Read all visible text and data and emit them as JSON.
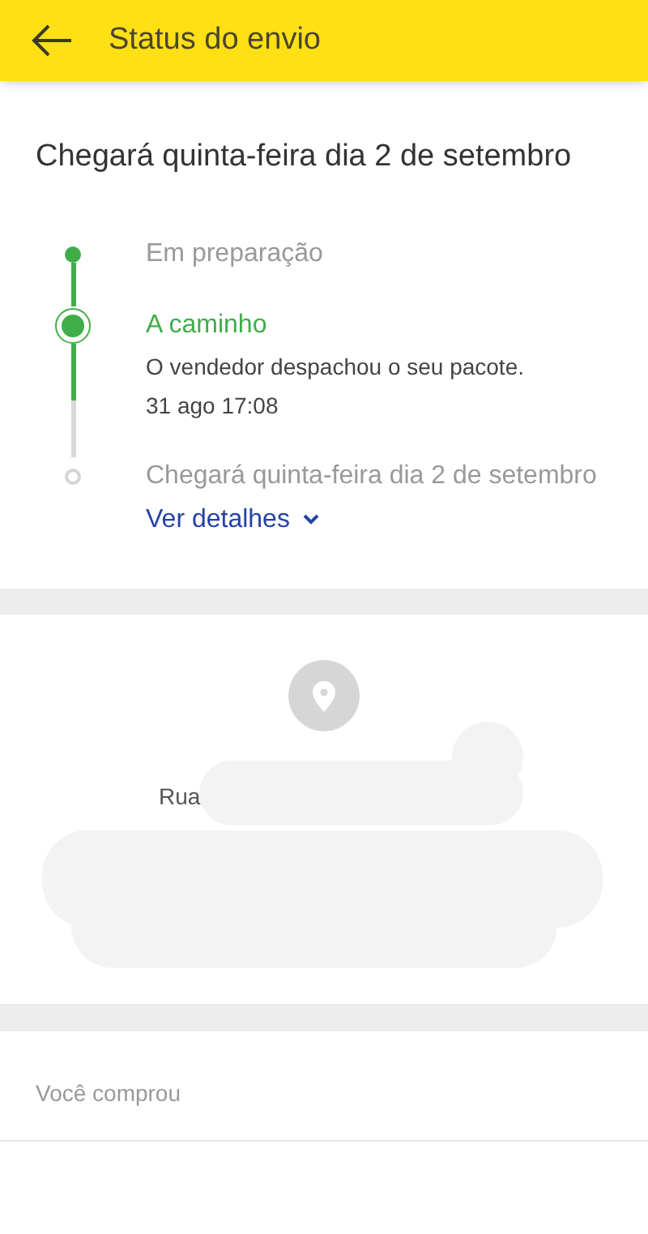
{
  "header": {
    "title": "Status do envio"
  },
  "delivery_estimate": "Chegará quinta-feira dia 2 de setembro",
  "timeline": [
    {
      "reached": true,
      "current": false,
      "title": "Em preparação"
    },
    {
      "reached": true,
      "current": true,
      "title": "A caminho",
      "description": "O vendedor despachou o seu pacote.",
      "date": "31 ago 17:08"
    },
    {
      "reached": false,
      "current": false,
      "title": "Chegará quinta-feira dia 2 de setembro",
      "link": "Ver detalhes"
    }
  ],
  "address": {
    "text": "Rua",
    "redacted": true
  },
  "purchase": {
    "title": "Você comprou"
  }
}
